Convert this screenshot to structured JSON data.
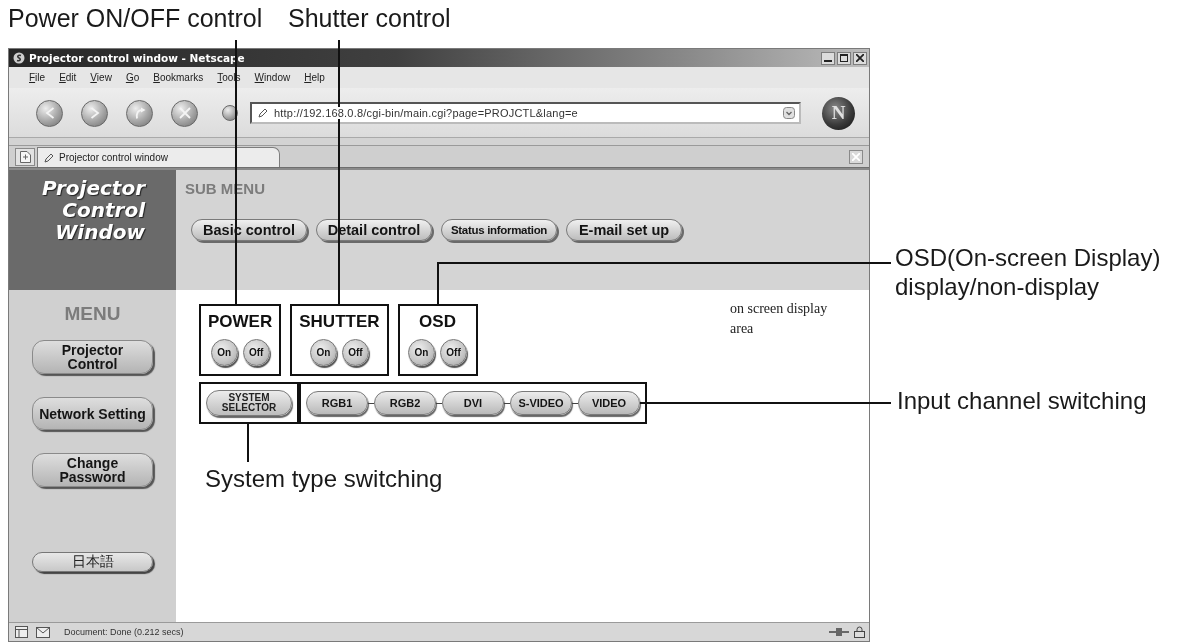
{
  "callouts": [
    {
      "kind": "power",
      "text": "Power ON/OFF control"
    },
    {
      "kind": "shutter",
      "text": "Shutter control"
    },
    {
      "kind": "osd",
      "text": "OSD(On-screen Display) display/non-display"
    },
    {
      "kind": "input",
      "text": "Input channel switching"
    },
    {
      "kind": "system",
      "text": "System type switching"
    }
  ],
  "window": {
    "title": "Projector control window - Netscape"
  },
  "menu_bar": [
    "File",
    "Edit",
    "View",
    "Go",
    "Bookmarks",
    "Tools",
    "Window",
    "Help"
  ],
  "address_bar": {
    "value": "http://192.168.0.8/cgi-bin/main.cgi?page=PROJCTL&lang=e"
  },
  "browser_logo": "N",
  "tabs": [
    {
      "label": "Projector control window",
      "selected": true
    }
  ],
  "page": {
    "logo": "Projector Control Window",
    "sub_menu": {
      "title": "SUB MENU",
      "buttons": [
        "Basic control",
        "Detail control",
        "Status information",
        "E-mail set up"
      ]
    },
    "menu": {
      "title": "MENU",
      "buttons": [
        "Projector\nControl",
        "Network Setting",
        "Change\nPassword"
      ],
      "language_button": "日本語"
    },
    "controls": [
      {
        "title": "POWER",
        "buttons": [
          "On",
          "Off"
        ]
      },
      {
        "title": "SHUTTER",
        "buttons": [
          "On",
          "Off"
        ]
      },
      {
        "title": "OSD",
        "buttons": [
          "On",
          "Off"
        ]
      }
    ],
    "system_selector": "SYSTEM\nSELECTOR",
    "inputs": [
      "RGB1",
      "RGB2",
      "DVI",
      "S-VIDEO",
      "VIDEO"
    ],
    "osd_area_text": "on screen display area"
  },
  "status_bar": {
    "text": "Document: Done (0.212 secs)"
  }
}
